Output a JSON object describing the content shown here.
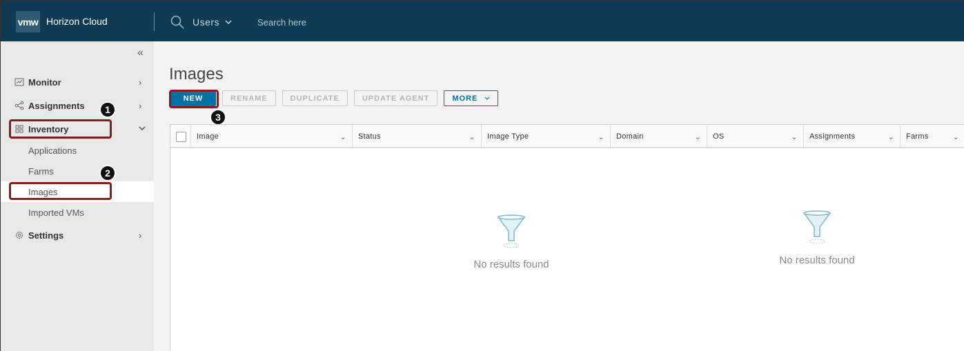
{
  "header": {
    "logo_text": "vmw",
    "app_title": "Horizon Cloud",
    "scope_label": "Users",
    "search_placeholder": "Search here",
    "bg_color": "#0e3a54"
  },
  "sidebar": {
    "items": [
      {
        "label": "Monitor",
        "icon": "chart-icon"
      },
      {
        "label": "Assignments",
        "icon": "share-icon"
      },
      {
        "label": "Inventory",
        "icon": "grid-icon"
      },
      {
        "label": "Settings",
        "icon": "gear-icon"
      }
    ],
    "inventory_children": [
      "Applications",
      "Farms",
      "Images",
      "Imported VMs"
    ],
    "active_child": "Images"
  },
  "steps": [
    "1",
    "2",
    "3"
  ],
  "main": {
    "title": "Images",
    "toolbar": {
      "new": "NEW",
      "rename": "RENAME",
      "duplicate": "DUPLICATE",
      "update_agent": "UPDATE AGENT",
      "more": "MORE"
    },
    "columns": [
      "Image",
      "Status",
      "Image Type",
      "Domain",
      "OS",
      "Assignments",
      "Farms"
    ],
    "empty_text": "No results found"
  },
  "colors": {
    "primary": "#0072a3",
    "highlight": "#8b1a1a"
  }
}
